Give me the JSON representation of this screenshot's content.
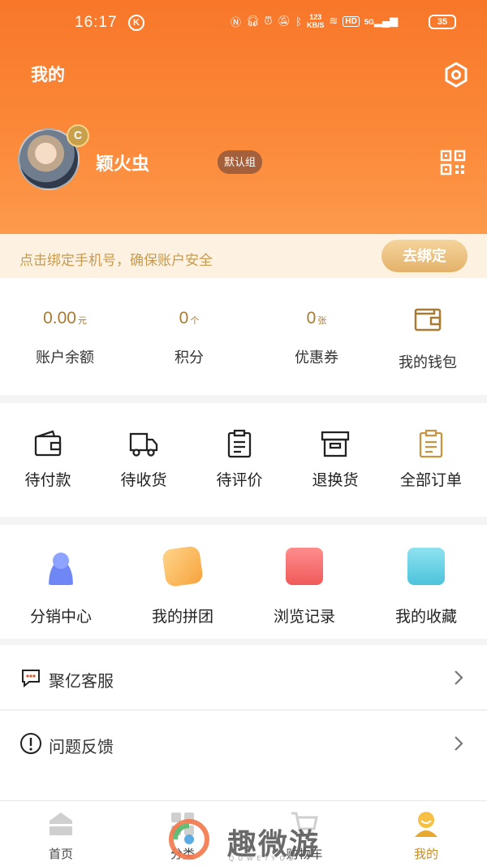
{
  "status_bar": {
    "time": "16:17",
    "mark": "K",
    "net_speed_top": "123",
    "net_speed_bottom": "KB/S",
    "hd": "HD",
    "signal": "5G",
    "battery": "35"
  },
  "header": {
    "title": "我的",
    "settings_icon": "hexagon-gear-icon",
    "qr_icon": "qr-code-icon"
  },
  "profile": {
    "username": "颖火虫",
    "group": "默认组",
    "badge": "C"
  },
  "bind_phone": {
    "message": "点击绑定手机号，确保账户安全",
    "button": "去绑定"
  },
  "assets": [
    {
      "value": "0.00",
      "unit": "元",
      "label": "账户余额"
    },
    {
      "value": "0",
      "unit": "个",
      "label": "积分"
    },
    {
      "value": "0",
      "unit": "张",
      "label": "优惠券"
    },
    {
      "label": "我的钱包",
      "icon": "wallet-icon"
    }
  ],
  "orders": [
    {
      "label": "待付款",
      "icon": "wallet-icon"
    },
    {
      "label": "待收货",
      "icon": "truck-icon"
    },
    {
      "label": "待评价",
      "icon": "clipboard-icon"
    },
    {
      "label": "退换货",
      "icon": "return-box-icon"
    },
    {
      "label": "全部订单",
      "icon": "order-list-icon"
    }
  ],
  "services": [
    {
      "label": "分销中心",
      "icon": "distribution-user-icon"
    },
    {
      "label": "我的拼团",
      "icon": "group-buy-icon"
    },
    {
      "label": "浏览记录",
      "icon": "history-icon"
    },
    {
      "label": "我的收藏",
      "icon": "favorites-folder-icon"
    }
  ],
  "menu": [
    {
      "label": "聚亿客服",
      "icon": "chat-bubble-icon"
    },
    {
      "label": "问题反馈",
      "icon": "exclamation-circle-icon"
    }
  ],
  "tabbar": [
    {
      "label": "首页",
      "icon": "home-icon"
    },
    {
      "label": "分类",
      "icon": "category-grid-icon"
    },
    {
      "label": "购物车",
      "icon": "cart-icon"
    },
    {
      "label": "我的",
      "icon": "profile-icon",
      "active": true
    }
  ],
  "watermark": {
    "text": "趣微游",
    "sub": "QUWEIYOU"
  },
  "colors": {
    "header_top": "#f8772a",
    "header_bottom": "#fd9a4c",
    "gold": "#a87b34",
    "bind_bg": "#fdf2e2"
  }
}
